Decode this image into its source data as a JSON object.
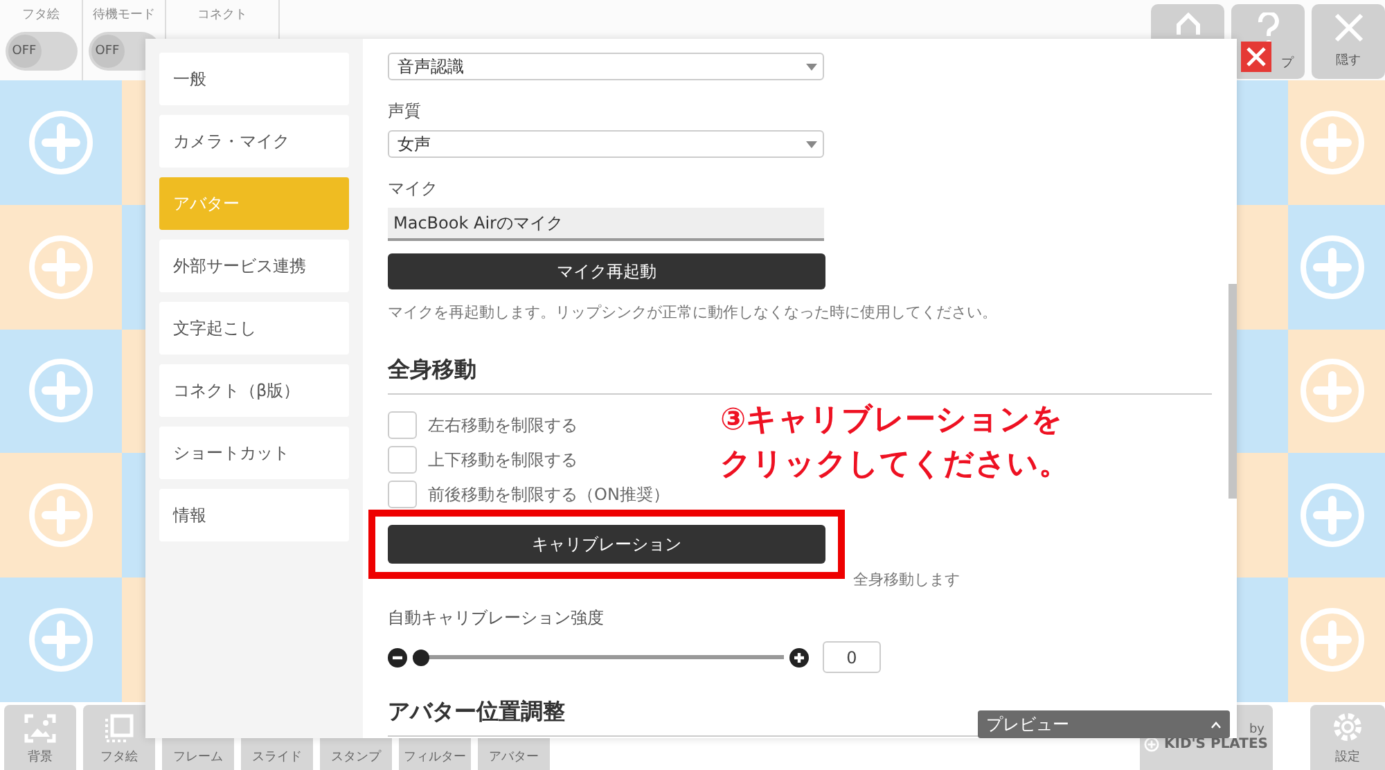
{
  "top_bar": {
    "toggles": [
      {
        "label": "フタ絵",
        "state_text": "OFF",
        "on": false
      },
      {
        "label": "待機モード",
        "state_text": "OFF",
        "on": false
      }
    ],
    "tab": {
      "label": "コネクト"
    },
    "buttons": [
      {
        "kind": "home"
      },
      {
        "kind": "help",
        "label": "プ"
      },
      {
        "kind": "hide",
        "label": "隠す"
      }
    ]
  },
  "bottom_bar": {
    "items": [
      {
        "kind": "background",
        "label": "背景"
      },
      {
        "kind": "lid",
        "label": "フタ絵"
      },
      {
        "kind": "hidden",
        "label": "フレーム"
      },
      {
        "kind": "hidden",
        "label": "スライド"
      },
      {
        "kind": "hidden",
        "label": "スタンプ"
      },
      {
        "kind": "hidden",
        "label": "フィルター"
      },
      {
        "kind": "hidden",
        "label": "アバター"
      }
    ],
    "brand": {
      "by": "by",
      "name": "KID'S PLATES"
    },
    "settings": {
      "label": "設定"
    }
  },
  "modal": {
    "sidebar": [
      {
        "label": "一般",
        "selected": false
      },
      {
        "label": "カメラ・マイク",
        "selected": false
      },
      {
        "label": "アバター",
        "selected": true
      },
      {
        "label": "外部サービス連携",
        "selected": false
      },
      {
        "label": "文字起こし",
        "selected": false
      },
      {
        "label": "コネクト（β版）",
        "selected": false
      },
      {
        "label": "ショートカット",
        "selected": false
      },
      {
        "label": "情報",
        "selected": false
      }
    ],
    "voice_select": {
      "value": "音声認識"
    },
    "voice_quality": {
      "label": "声質",
      "value": "女声"
    },
    "mic": {
      "label": "マイク",
      "value": "MacBook Airのマイク"
    },
    "mic_restart_button": "マイク再起動",
    "mic_help": "マイクを再起動します。リップシンクが正常に動作しなくなった時に使用してください。",
    "whole_body": {
      "heading": "全身移動",
      "checkboxes": [
        {
          "label": "左右移動を制限する",
          "checked": false
        },
        {
          "label": "上下移動を制限する",
          "checked": false
        },
        {
          "label": "前後移動を制限する（ON推奨）",
          "checked": false
        }
      ],
      "calibration_button": "キャリブレーション",
      "description": "全身移動します",
      "strength": {
        "label": "自動キャリブレーション強度",
        "level": 0,
        "value": "0"
      }
    },
    "next_heading": "アバター位置調整",
    "preview": {
      "label": "プレビュー"
    }
  },
  "annotation": {
    "lines": [
      "③キャリブレーションを",
      "クリックしてください。"
    ]
  }
}
